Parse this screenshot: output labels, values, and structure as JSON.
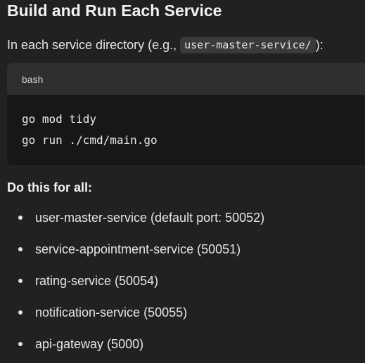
{
  "section": {
    "title": "Build and Run Each Service",
    "intro_prefix": "In each service directory (e.g., ",
    "intro_code": "user-master-service/",
    "intro_suffix": "):"
  },
  "code_block": {
    "language": "bash",
    "lines": [
      "go mod tidy",
      "go run ./cmd/main.go"
    ]
  },
  "services_heading": "Do this for all:",
  "services": [
    "user-master-service (default port: 50052)",
    "service-appointment-service (50051)",
    "rating-service (50054)",
    "notification-service (50055)",
    "api-gateway (5000)"
  ]
}
